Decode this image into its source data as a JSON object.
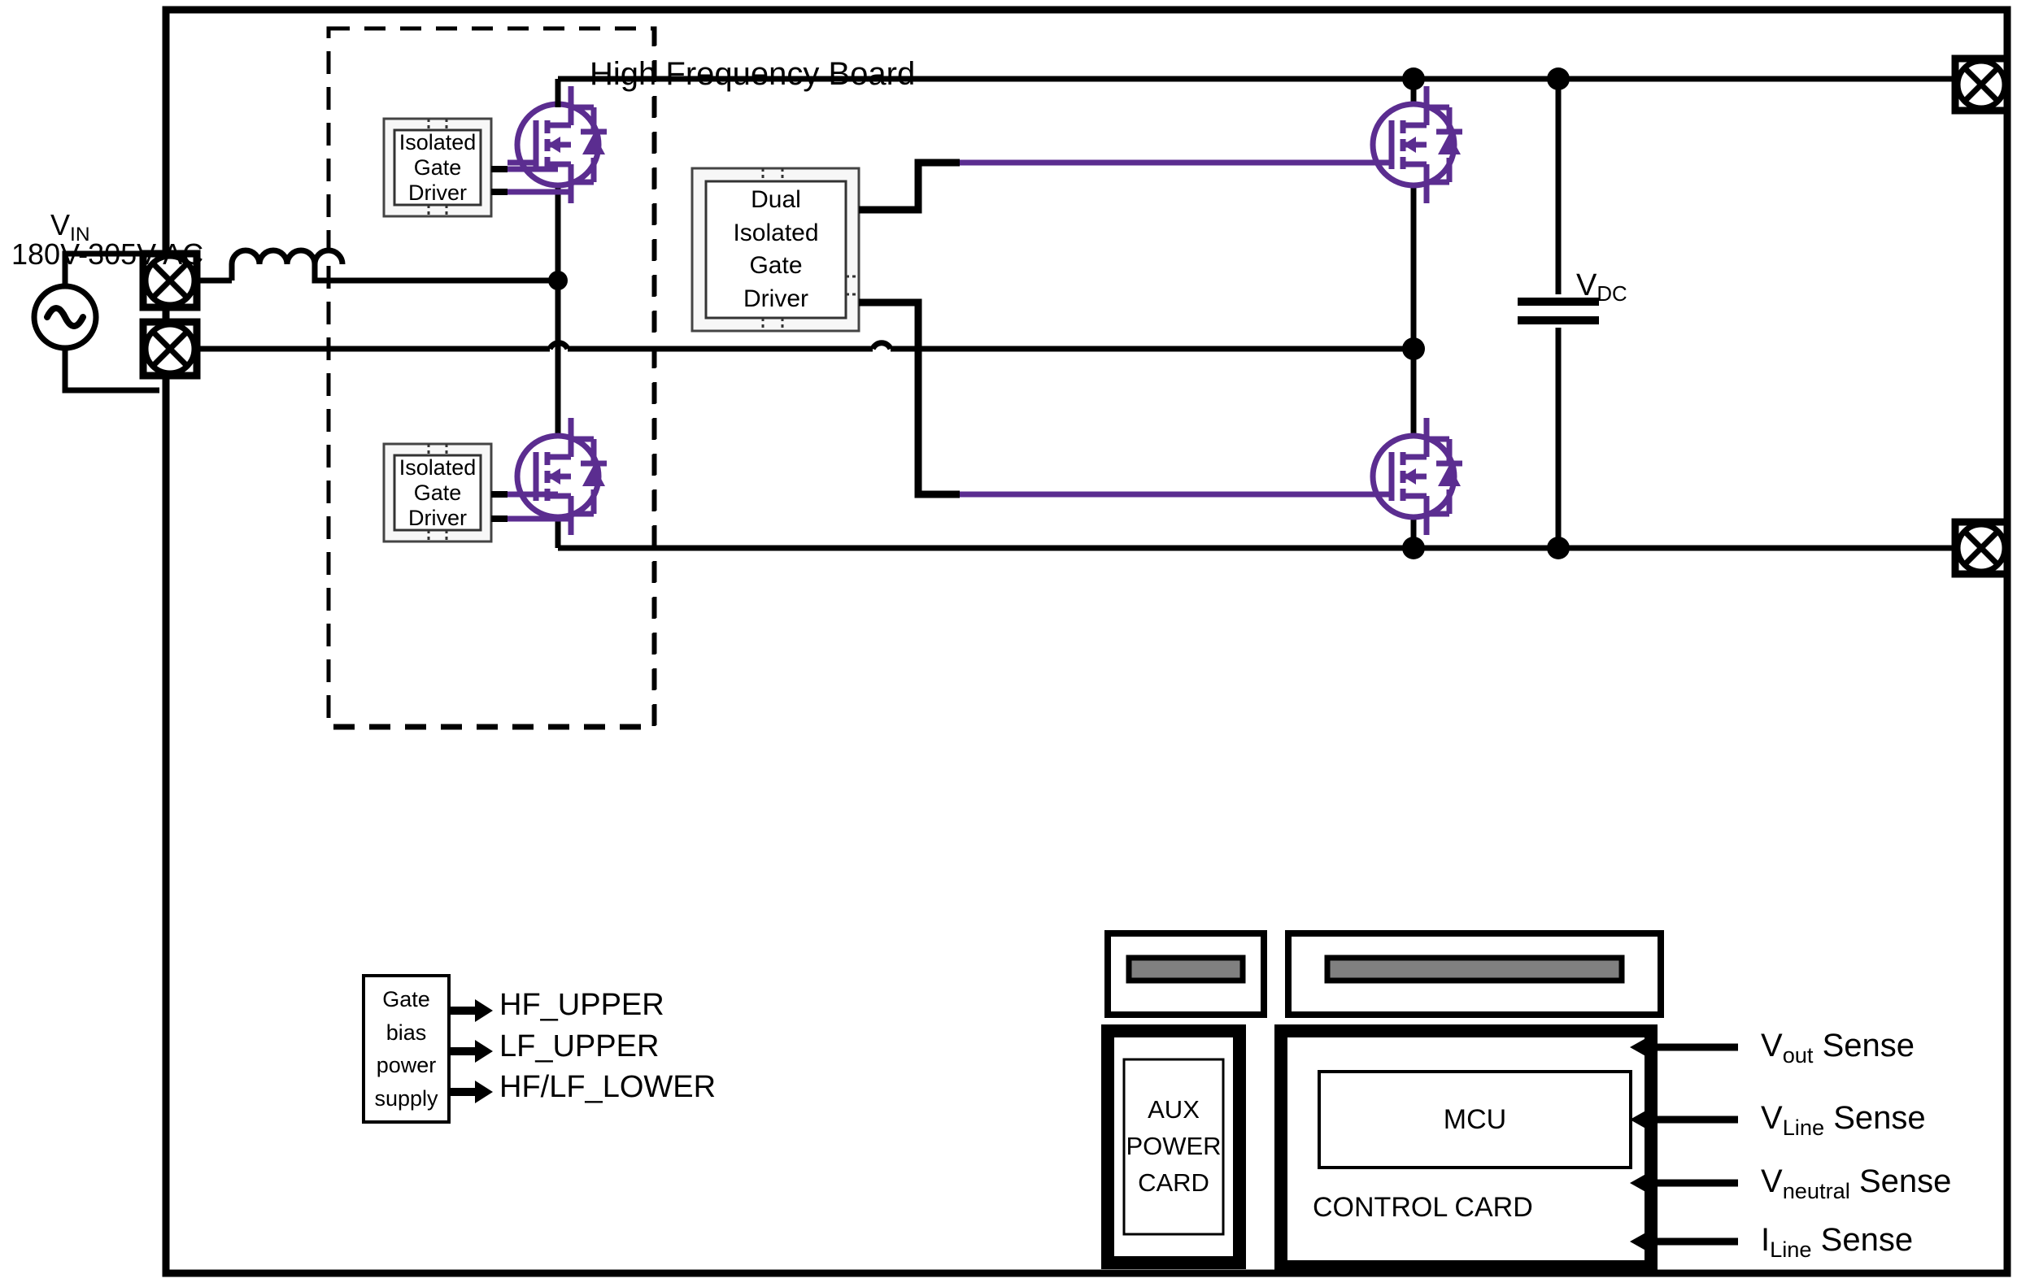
{
  "diagram": {
    "title_label": "High Frequency Board",
    "input": {
      "vin_label": "V",
      "vin_sub": "IN",
      "vin_range": "180V-305V AC",
      "source_icon": "ac-source-icon",
      "inductor_icon": "inductor-icon",
      "terminal_icon": "terminal-icon"
    },
    "gate_drivers": [
      {
        "id": "hf-upper",
        "lines": [
          "Isolated",
          "Gate",
          "Driver"
        ]
      },
      {
        "id": "hf-lower",
        "lines": [
          "Isolated",
          "Gate",
          "Driver"
        ]
      },
      {
        "id": "dual-lf",
        "lines": [
          "Dual",
          "Isolated",
          "Gate",
          "Driver"
        ]
      }
    ],
    "mosfets": [
      {
        "id": "hf-upper-fet",
        "icon": "mosfet-icon"
      },
      {
        "id": "hf-lower-fet",
        "icon": "mosfet-icon"
      },
      {
        "id": "lf-upper-fet",
        "icon": "mosfet-icon"
      },
      {
        "id": "lf-lower-fet",
        "icon": "mosfet-icon"
      }
    ],
    "bus": {
      "vdc_label": "V",
      "vdc_sub": "DC",
      "capacitor_icon": "capacitor-icon"
    },
    "gate_bias": {
      "lines": [
        "Gate bias",
        "power",
        "supply"
      ],
      "outputs": [
        "HF_UPPER",
        "LF_UPPER",
        "HF/LF_LOWER"
      ]
    },
    "cards": {
      "aux_power": {
        "lines": [
          "AUX",
          "POWER",
          "CARD"
        ]
      },
      "control": {
        "mcu_label": "MCU",
        "card_label": "CONTROL CARD"
      },
      "connector_icon": "card-edge-connector-icon"
    },
    "sense_signals": [
      {
        "name": "V",
        "sub": "out",
        "suffix": " Sense"
      },
      {
        "name": "V",
        "sub": "Line",
        "suffix": " Sense"
      },
      {
        "name": "V",
        "sub": "neutral",
        "suffix": " Sense"
      },
      {
        "name": "I",
        "sub": "Line",
        "suffix": " Sense"
      }
    ],
    "colors": {
      "wire": "#000000",
      "semiconductor": "#5b2d90",
      "connector_slot": "#808080",
      "driver_fill": "#f7f7f7",
      "background": "#ffffff"
    }
  }
}
